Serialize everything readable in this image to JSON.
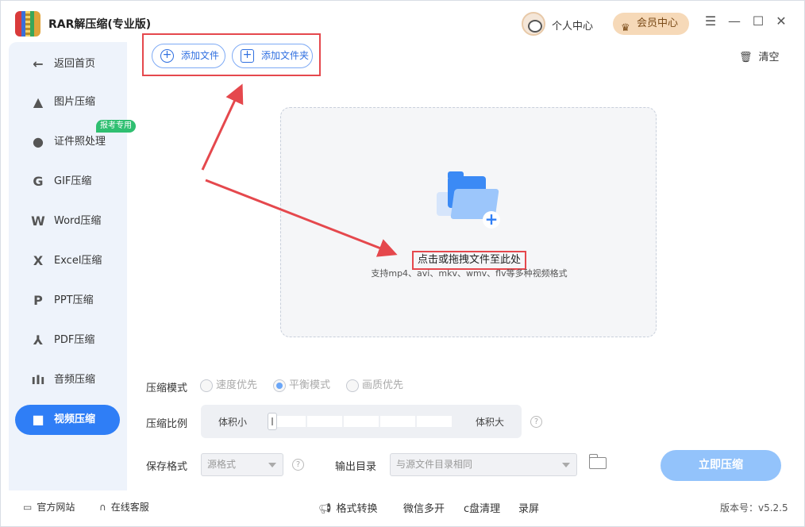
{
  "app": {
    "title": "RAR解压缩(专业版)"
  },
  "header": {
    "user_center": "个人中心",
    "vip_center": "会员中心",
    "window_controls": [
      "menu-icon",
      "minimize-icon",
      "maximize-icon",
      "close-icon"
    ]
  },
  "sidebar": {
    "back": "返回首页",
    "badge": "报考专用",
    "items": [
      {
        "label": "图片压缩",
        "icon": "image-compress-icon",
        "active": false
      },
      {
        "label": "证件照处理",
        "icon": "id-photo-icon",
        "active": false
      },
      {
        "label": "GIF压缩",
        "icon": "gif-compress-icon",
        "active": false
      },
      {
        "label": "Word压缩",
        "icon": "word-compress-icon",
        "active": false
      },
      {
        "label": "Excel压缩",
        "icon": "excel-compress-icon",
        "active": false
      },
      {
        "label": "PPT压缩",
        "icon": "ppt-compress-icon",
        "active": false
      },
      {
        "label": "PDF压缩",
        "icon": "pdf-compress-icon",
        "active": false
      },
      {
        "label": "音频压缩",
        "icon": "audio-compress-icon",
        "active": false
      },
      {
        "label": "视频压缩",
        "icon": "video-compress-icon",
        "active": true
      }
    ]
  },
  "toolbar": {
    "add_file": "添加文件",
    "add_folder": "添加文件夹",
    "clear": "清空"
  },
  "dropzone": {
    "title": "点击或拖拽文件至此处",
    "subtitle": "支持mp4、avi、mkv、wmv、flv等多种视频格式"
  },
  "settings": {
    "mode_label": "压缩模式",
    "modes": [
      {
        "label": "速度优先",
        "checked": false
      },
      {
        "label": "平衡模式",
        "checked": true
      },
      {
        "label": "画质优先",
        "checked": false
      }
    ],
    "ratio_label": "压缩比例",
    "ratio_min": "体积小",
    "ratio_max": "体积大",
    "ratio_value": 0,
    "format_label": "保存格式",
    "format_value": "源格式",
    "output_label": "输出目录",
    "output_value": "与源文件目录相同",
    "compress_button": "立即压缩"
  },
  "footer": {
    "website": "官方网站",
    "support": "在线客服",
    "format_convert": "格式转换",
    "wechat": "微信多开",
    "disk_clean": "c盘清理",
    "record": "录屏",
    "version": "版本号：v5.2.5"
  },
  "colors": {
    "accent": "#2f7ef6",
    "annotation": "#e5484d",
    "sidebar_bg": "#eef3fb",
    "badge": "#2fbf71",
    "vip": "#f6d9b8"
  }
}
